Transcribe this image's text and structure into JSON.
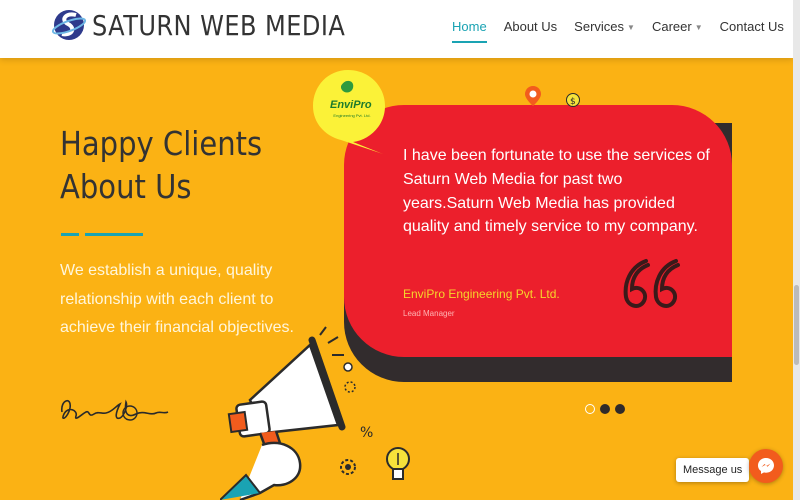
{
  "header": {
    "brand": "SATURN WEB MEDIA",
    "nav": [
      {
        "label": "Home",
        "active": true,
        "dropdown": false
      },
      {
        "label": "About Us",
        "active": false,
        "dropdown": false
      },
      {
        "label": "Services",
        "active": false,
        "dropdown": true
      },
      {
        "label": "Career",
        "active": false,
        "dropdown": true
      },
      {
        "label": "Contact Us",
        "active": false,
        "dropdown": false
      }
    ]
  },
  "section": {
    "title_line1": "Happy Clients",
    "title_line2": "About Us",
    "description": "We establish a unique, quality relationship with each client to achieve their financial objectives."
  },
  "testimonial": {
    "client_logo_title": "EnviPro",
    "client_logo_sub": "Engineering Pvt. Ltd.",
    "quote": "I have been fortunate to use the services of Saturn Web Media for past two years.Saturn Web Media has provided quality and timely service to my company.",
    "client_name": "EnviPro Engineering Pvt. Ltd.",
    "client_role": "Lead Manager"
  },
  "carousel": {
    "slide_count": 3,
    "active_index": 0
  },
  "chat_widget": {
    "label": "Message us"
  },
  "colors": {
    "background": "#fbb214",
    "accent": "#1aa3b3",
    "card": "#ec1f2c",
    "card_shadow": "#322c2d",
    "messenger": "#f25c1d"
  },
  "icons": [
    "saturn-logo-icon",
    "chevron-down-icon",
    "megaphone-icon",
    "quote-icon",
    "lightbulb-icon",
    "gear-icon",
    "percent-icon",
    "location-pin-icon",
    "dollar-icon",
    "messenger-icon"
  ]
}
